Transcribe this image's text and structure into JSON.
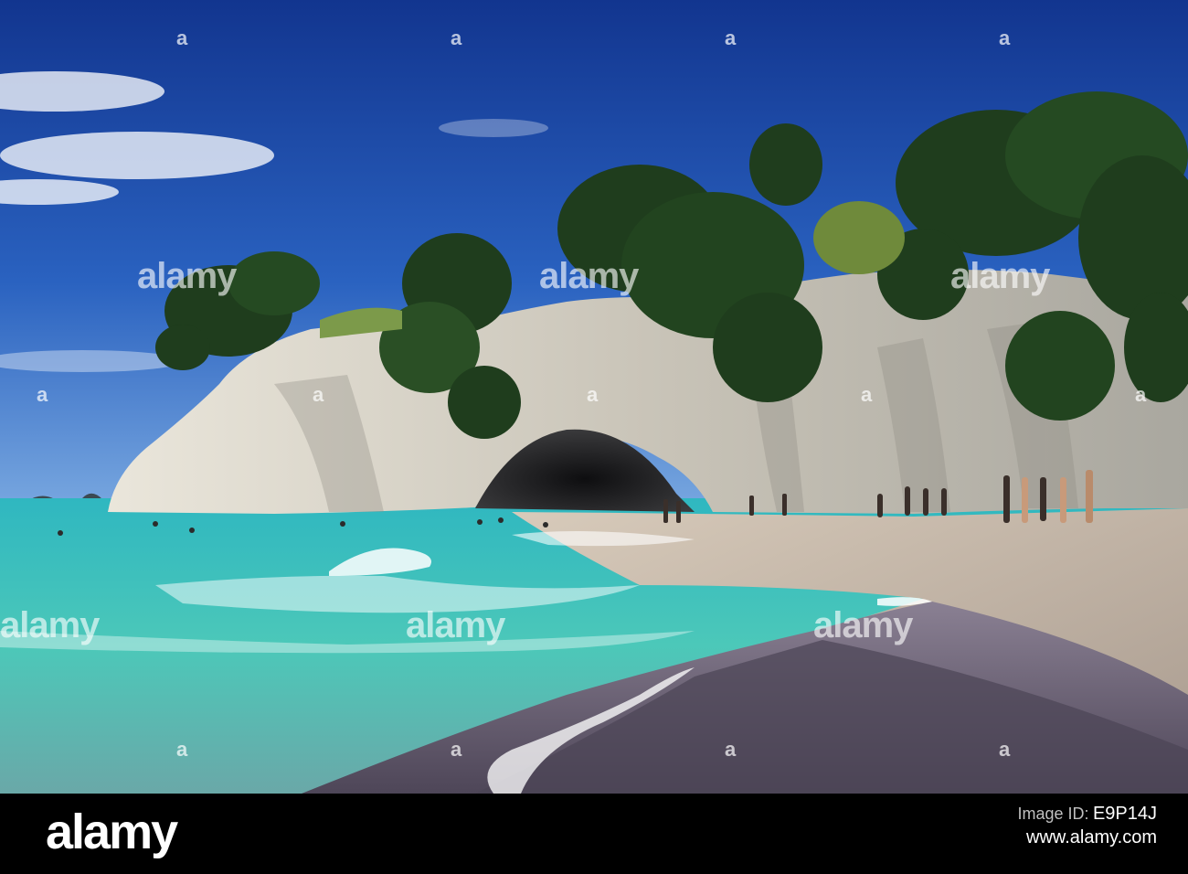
{
  "watermark": {
    "text": "alamy",
    "mark": "a"
  },
  "footer": {
    "brand": "alamy",
    "image_id_label": "Image ID:",
    "image_id": "E9P14J",
    "site": "www.alamy.com"
  },
  "colors": {
    "sky_top": "#14389a",
    "sky_bottom": "#5a8fd8",
    "sea": "#3cc2b9",
    "sand": "#c9b8a4",
    "wet_sand": "#5d5568",
    "cliff": "#d9d4c8",
    "trees": "#1e3f1c",
    "footer_bg": "#000000"
  }
}
